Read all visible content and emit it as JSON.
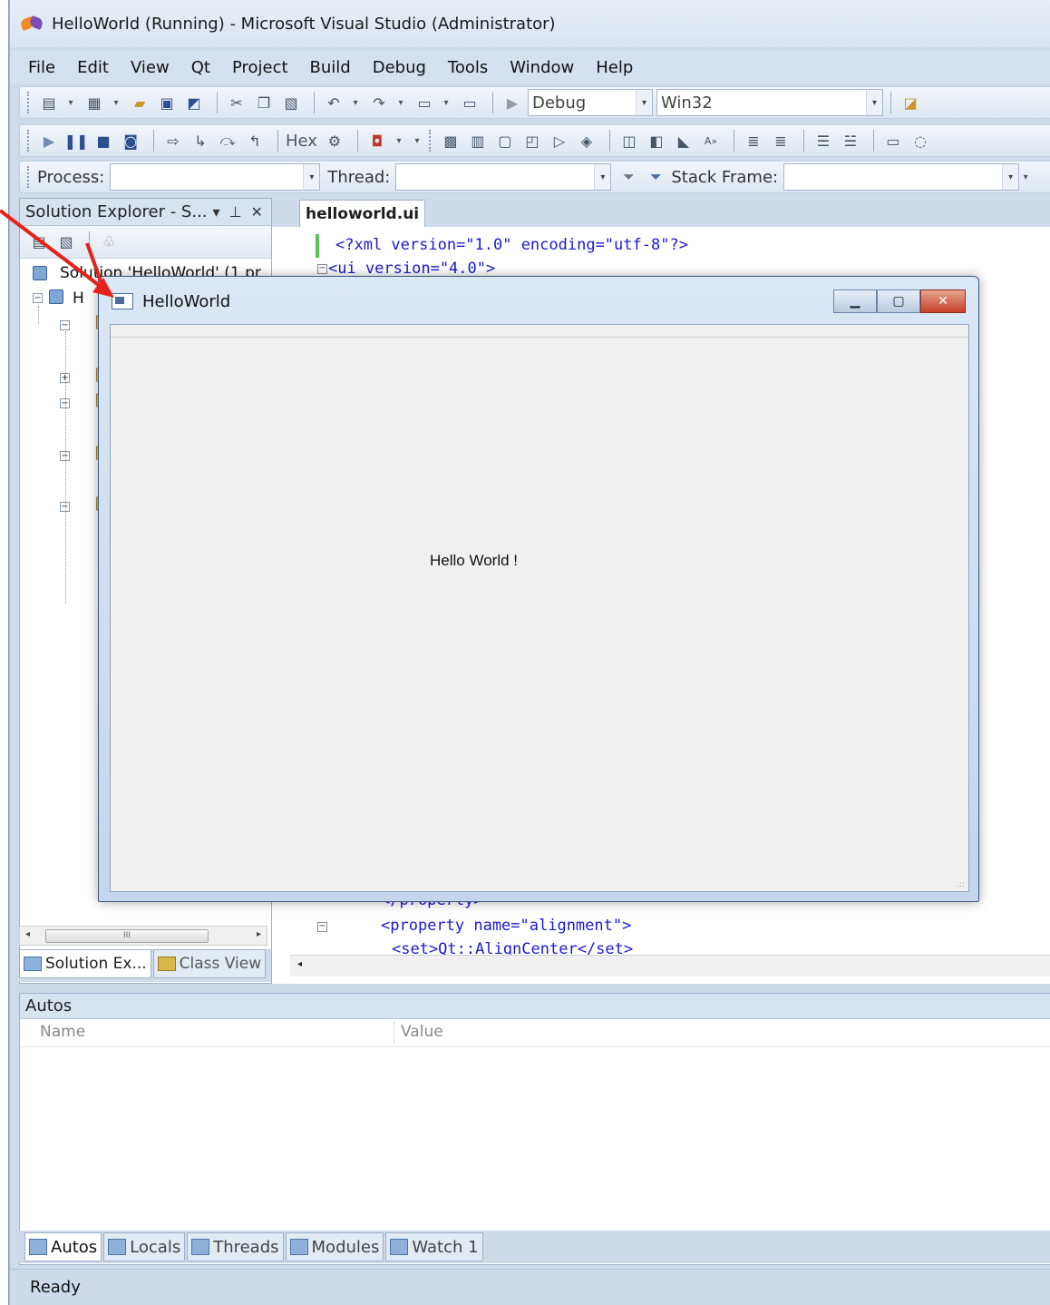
{
  "window": {
    "title": "HelloWorld (Running) - Microsoft Visual Studio (Administrator)"
  },
  "menu": [
    "File",
    "Edit",
    "View",
    "Qt",
    "Project",
    "Build",
    "Debug",
    "Tools",
    "Window",
    "Help"
  ],
  "toolbar1": {
    "config": "Debug",
    "platform": "Win32"
  },
  "toolbar2": {
    "hex_label": "Hex"
  },
  "toolbar3": {
    "process_label": "Process:",
    "thread_label": "Thread:",
    "stack_frame_label": "Stack Frame:"
  },
  "solution_explorer": {
    "title": "Solution Explorer - S...",
    "solution_row": "Solution 'HelloWorld' (1 pr",
    "project_row_initial": "H",
    "tabs": [
      "Solution Ex...",
      "Class View"
    ]
  },
  "editor": {
    "tab": "helloworld.ui",
    "lines": {
      "l1": "<?xml version=\"1.0\" encoding=\"utf-8\"?>",
      "l2": "<ui version=\"4.0\">",
      "l3": "</property>",
      "l4": "<property name=\"alignment\">",
      "l5": "<set>Qt::AlignCenter</set>"
    }
  },
  "autos": {
    "title": "Autos",
    "columns": {
      "name": "Name",
      "value": "Value"
    }
  },
  "debug_tabs": [
    "Autos",
    "Locals",
    "Threads",
    "Modules",
    "Watch 1"
  ],
  "status": "Ready",
  "app_window": {
    "title": "HelloWorld",
    "label": "Hello World !"
  },
  "colors": {
    "annotation_arrow": "#e8201a",
    "close_button": "#c6402a"
  }
}
